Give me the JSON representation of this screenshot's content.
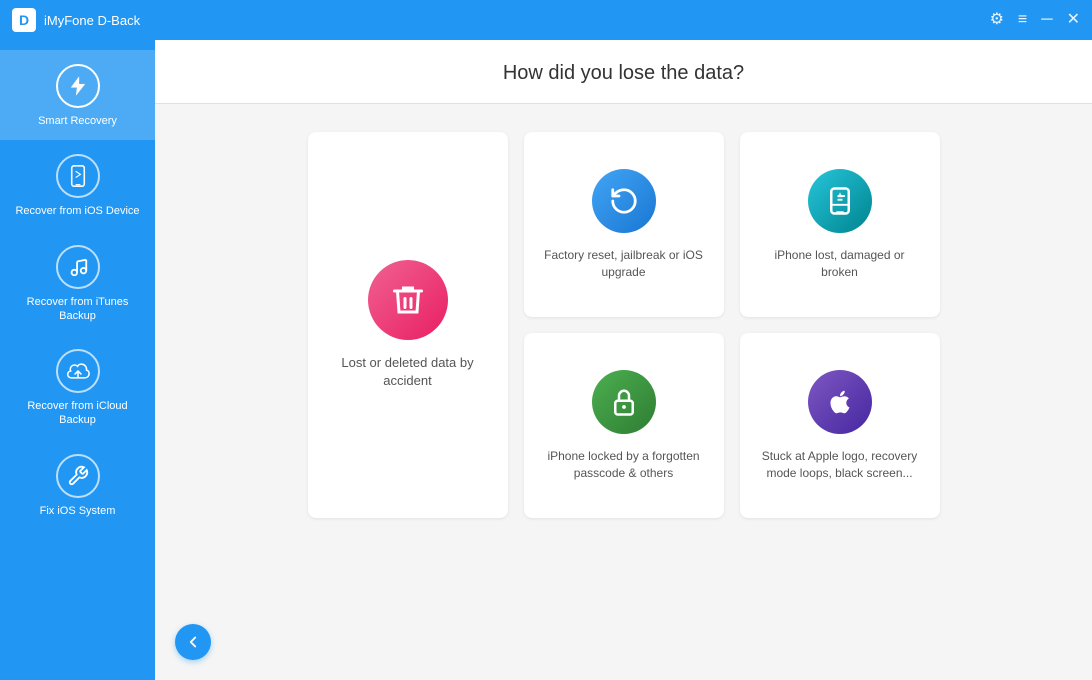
{
  "titleBar": {
    "logo": "D",
    "title": "iMyFone D-Back"
  },
  "titleBarControls": {
    "settings": "⚙",
    "menu": "≡",
    "minimize": "─",
    "close": "✕"
  },
  "sidebar": {
    "items": [
      {
        "id": "smart-recovery",
        "label": "Smart Recovery",
        "icon": "lightning",
        "active": true
      },
      {
        "id": "ios-device",
        "label": "Recover from iOS Device",
        "icon": "phone",
        "active": false
      },
      {
        "id": "itunes",
        "label": "Recover from iTunes Backup",
        "icon": "music",
        "active": false
      },
      {
        "id": "icloud",
        "label": "Recover from iCloud Backup",
        "icon": "cloud",
        "active": false
      },
      {
        "id": "fix-ios",
        "label": "Fix iOS System",
        "icon": "wrench",
        "active": false
      }
    ]
  },
  "content": {
    "header": "How did you lose the data?",
    "cards": [
      {
        "id": "lost-deleted",
        "label": "Lost or deleted data by accident",
        "iconColor": "pink",
        "large": true
      },
      {
        "id": "factory-reset",
        "label": "Factory reset, jailbreak or iOS upgrade",
        "iconColor": "blue",
        "large": false
      },
      {
        "id": "iphone-lost",
        "label": "iPhone lost, damaged or broken",
        "iconColor": "teal",
        "large": false
      },
      {
        "id": "iphone-locked",
        "label": "iPhone locked by a forgotten passcode & others",
        "iconColor": "green",
        "large": false
      },
      {
        "id": "stuck-apple",
        "label": "Stuck at Apple logo, recovery mode loops, black screen...",
        "iconColor": "purple",
        "large": false
      }
    ],
    "backButton": "←"
  }
}
